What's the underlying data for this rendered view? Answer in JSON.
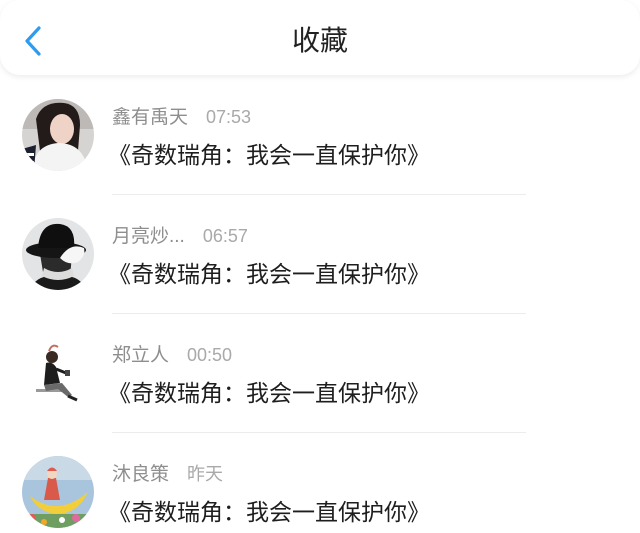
{
  "header": {
    "title": "收藏",
    "back_icon": "chevron-left-icon",
    "accent_color": "#2f9bef"
  },
  "favorites": [
    {
      "name": "鑫有禹天",
      "time": "07:53",
      "title": "《奇数瑞角：我会一直保护你》",
      "avatar": "user-avatar"
    },
    {
      "name": "月亮炒...",
      "time": "06:57",
      "title": "《奇数瑞角：我会一直保护你》",
      "avatar": "user-avatar"
    },
    {
      "name": "郑立人",
      "time": "00:50",
      "title": "《奇数瑞角：我会一直保护你》",
      "avatar": "user-avatar"
    },
    {
      "name": "沐良策",
      "time": "昨天",
      "title": "《奇数瑞角：我会一直保护你》",
      "avatar": "user-avatar"
    }
  ]
}
